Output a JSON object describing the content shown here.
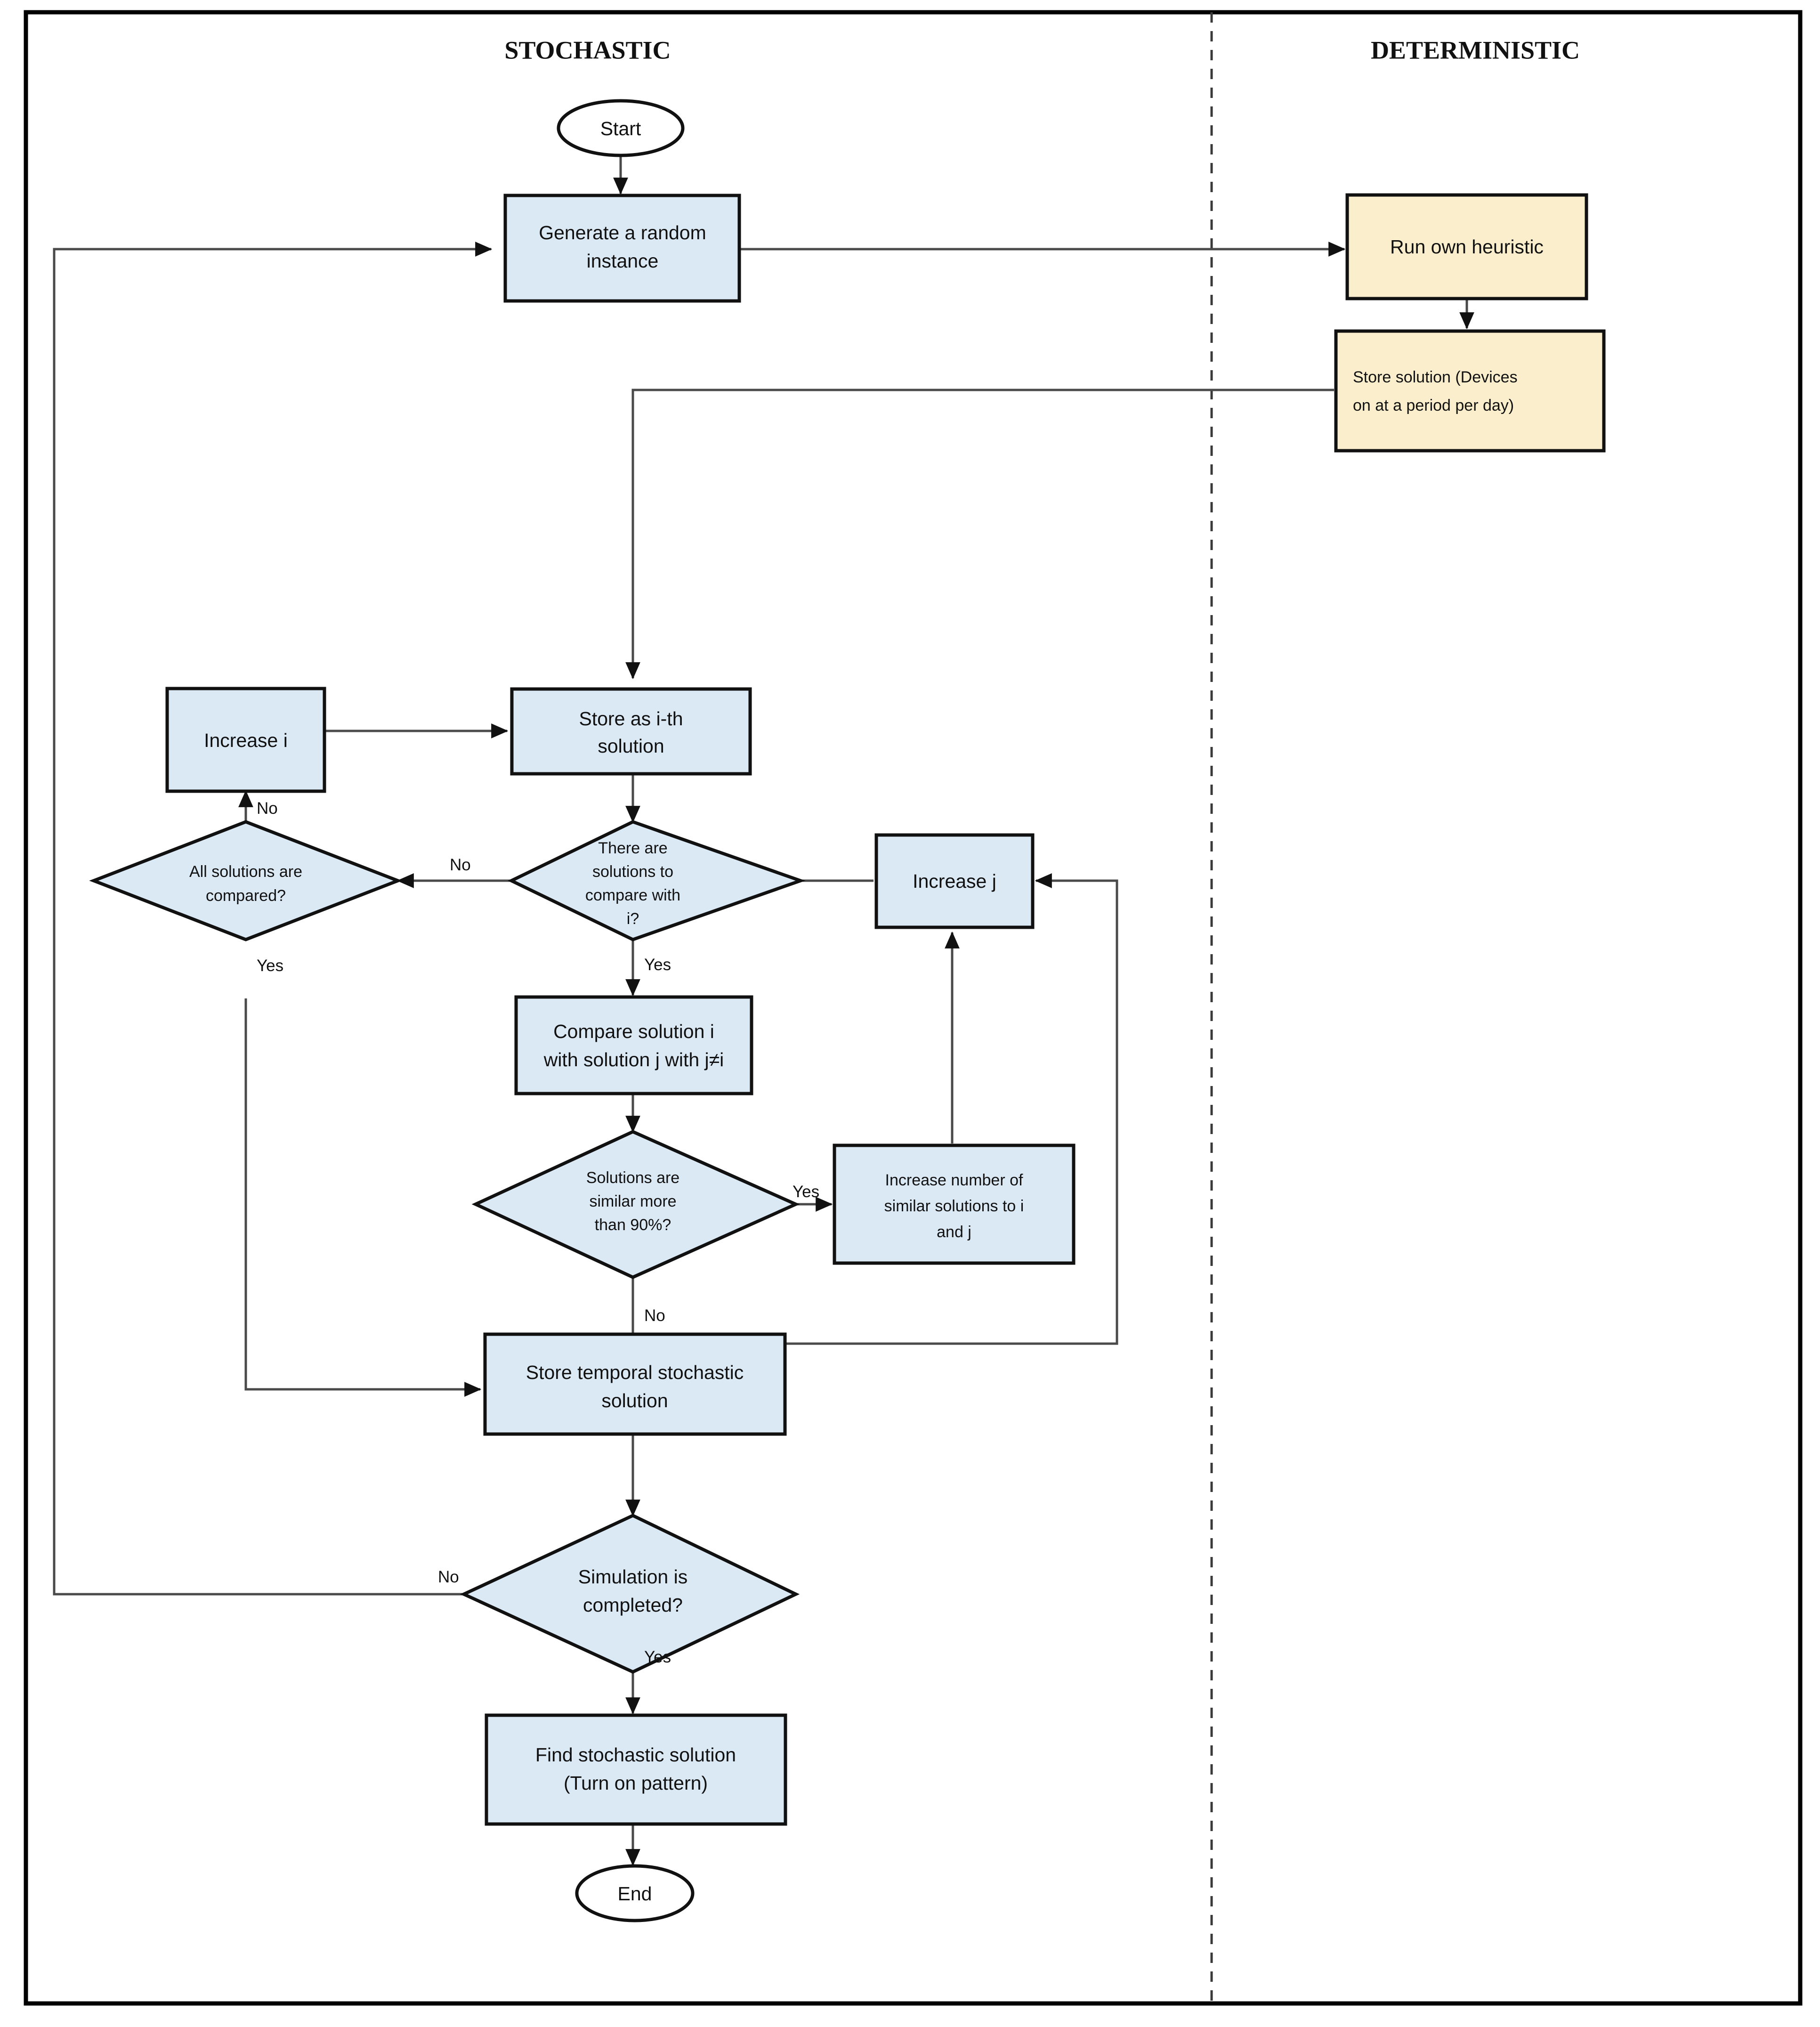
{
  "diagram": {
    "columns": [
      {
        "id": "stochastic",
        "title": "STOCHASTIC"
      },
      {
        "id": "deterministic",
        "title": "DETERMINISTIC"
      }
    ],
    "colors": {
      "process_blue_fill": "#dbe9f5",
      "process_yellow_fill": "#fbeecc",
      "shape_stroke": "#111111",
      "edge_stroke": "#4a4a4a",
      "frame_stroke": "#000000",
      "divider_stroke": "#3a3a3a",
      "terminator_fill": "#ffffff"
    },
    "nodes": {
      "start": {
        "label": "Start",
        "shape": "terminator"
      },
      "generate_instance": {
        "label_line1": "Generate a random",
        "label_line2": "instance",
        "shape": "process"
      },
      "run_heuristic": {
        "label": "Run own heuristic",
        "shape": "process"
      },
      "store_solution": {
        "label_line1": "Store solution (Devices",
        "label_line2": "on at a period per day)",
        "shape": "process"
      },
      "increase_i": {
        "label": "Increase i",
        "shape": "process"
      },
      "store_ith": {
        "label_line1": "Store as i-th",
        "label_line2": "solution",
        "shape": "process"
      },
      "all_compared": {
        "label_line1": "All solutions  are",
        "label_line2": "compared?",
        "shape": "decision"
      },
      "there_are_solutions": {
        "label_line1": "There are",
        "label_line2": "solutions to",
        "label_line3": "compare with",
        "label_line4": "i?",
        "shape": "decision"
      },
      "increase_j": {
        "label": "Increase j",
        "shape": "process"
      },
      "compare_solution": {
        "label_line1": "Compare solution i",
        "label_line2": "with solution j with j≠i",
        "shape": "process"
      },
      "similar_90": {
        "label_line1": "Solutions are",
        "label_line2": "similar more",
        "label_line3": "than 90%?",
        "shape": "decision"
      },
      "increase_similar": {
        "label_line1": "Increase number of",
        "label_line2": "similar solutions to i",
        "label_line3": "and j",
        "shape": "process"
      },
      "store_temporal": {
        "label_line1": "Store temporal stochastic",
        "label_line2": "solution",
        "shape": "process"
      },
      "simulation_completed": {
        "label_line1": "Simulation is",
        "label_line2": "completed?",
        "shape": "decision"
      },
      "find_stochastic": {
        "label_line1": "Find stochastic solution",
        "label_line2": "(Turn on pattern)",
        "shape": "process"
      },
      "end": {
        "label": "End",
        "shape": "terminator"
      }
    },
    "edge_labels": {
      "all_compared_no": "No",
      "all_compared_yes": "Yes",
      "there_are_solutions_no": "No",
      "there_are_solutions_yes": "Yes",
      "similar_90_yes": "Yes",
      "similar_90_no": "No",
      "simulation_completed_no": "No",
      "simulation_completed_yes": "Yes"
    }
  }
}
